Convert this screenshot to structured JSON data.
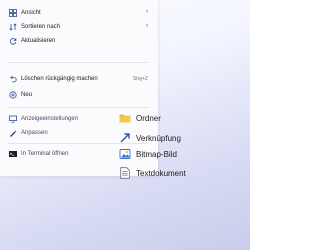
{
  "context_menu": {
    "items": [
      {
        "label": "Ansicht",
        "icon": "view-grid-icon",
        "has_submenu": true
      },
      {
        "label": "Sortieren nach",
        "icon": "sort-icon",
        "has_submenu": true
      },
      {
        "label": "Aktualisieren",
        "icon": "refresh-icon"
      },
      {
        "label": "Löschen rückgängig machen",
        "icon": "undo-icon",
        "shortcut": "Strg+Z"
      },
      {
        "label": "Neu",
        "icon": "new-icon"
      },
      {
        "label": "Anzeigeeinstellungen",
        "icon": "display-settings-icon"
      },
      {
        "label": "Anpassen",
        "icon": "personalize-icon"
      },
      {
        "label": "In Terminal öffnen",
        "icon": "terminal-icon"
      }
    ],
    "submenu_arrow": "›"
  },
  "new_submenu": {
    "items": [
      {
        "label": "Ordner",
        "icon": "folder-icon"
      },
      {
        "label": "Verknüpfung",
        "icon": "shortcut-arrow-icon"
      },
      {
        "label": "Bitmap-Bild",
        "icon": "bitmap-image-icon"
      },
      {
        "label": "Textdokument",
        "icon": "text-document-icon"
      }
    ]
  },
  "colors": {
    "accent": "#2a4d8f",
    "folder": "#e8b33a",
    "desktop": "#d9dcf4"
  }
}
